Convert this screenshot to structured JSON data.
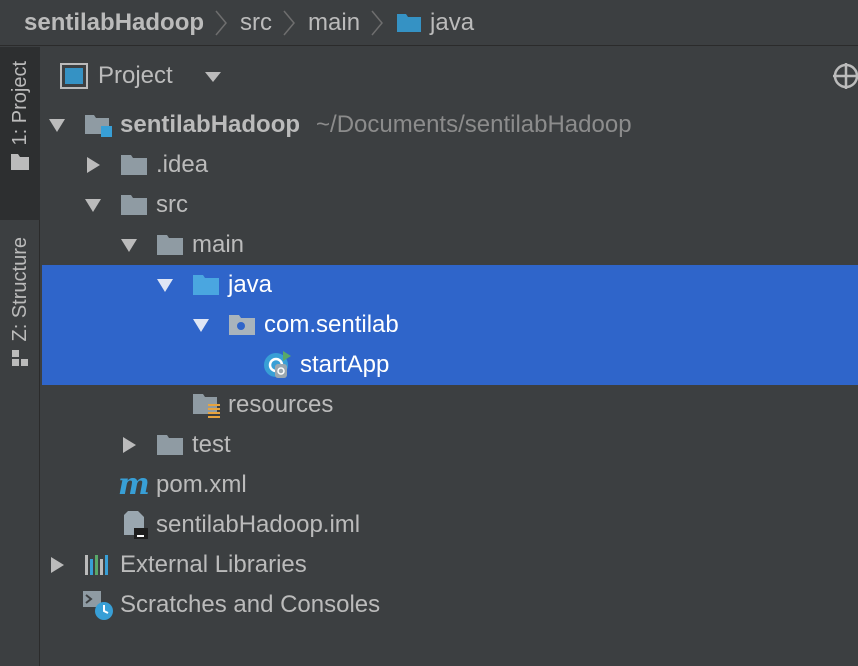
{
  "breadcrumb": {
    "project": "sentilabHadoop",
    "items": [
      "src",
      "main",
      "java"
    ]
  },
  "side_tabs": {
    "project": "1: Project",
    "structure": "Z: Structure"
  },
  "panel": {
    "title": "Project",
    "view_selector_icon": "chevron-down-icon",
    "locate_icon": "crosshair-icon"
  },
  "colors": {
    "background": "#3c3f41",
    "selection": "#2f65ca",
    "folder": "#8f9ba3",
    "source_folder": "#3592c4",
    "accent_blue": "#389fd6"
  },
  "tree": {
    "root_name": "sentilabHadoop",
    "root_path": "~/Documents/sentilabHadoop",
    "idea": ".idea",
    "src": "src",
    "main": "main",
    "java": "java",
    "package": "com.sentilab",
    "class": "startApp",
    "resources": "resources",
    "test": "test",
    "pom": "pom.xml",
    "iml": "sentilabHadoop.iml",
    "external_libraries": "External Libraries",
    "scratches": "Scratches and Consoles"
  }
}
